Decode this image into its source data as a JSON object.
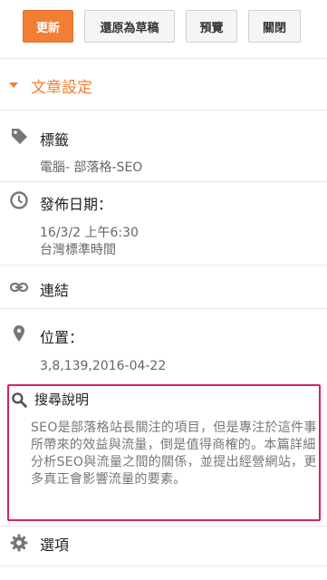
{
  "toolbar": {
    "update": "更新",
    "revert": "還原為草稿",
    "preview": "預覽",
    "close": "關閉"
  },
  "section": {
    "title": "文章設定"
  },
  "labels": {
    "label": "標籤",
    "value": "電腦- 部落格-SEO"
  },
  "publish": {
    "label": "發佈日期：",
    "date": "16/3/2 上午6:30",
    "timezone": "台灣標準時間"
  },
  "link": {
    "label": "連結"
  },
  "location": {
    "label": "位置：",
    "value": "3,8,139,2016-04-22"
  },
  "search_description": {
    "label": "搜尋說明",
    "text": "SEO是部落格站長關注的項目，但是專注於這件事所帶來的效益與流量，倒是值得商榷的。本篇詳細分析SEO與流量之間的關係，並提出經營網站，更多真正會影響流量的要素。"
  },
  "options": {
    "label": "選項"
  },
  "colors": {
    "accent": "#f27e35",
    "highlight": "#d81e6a",
    "icon": "#777777"
  }
}
